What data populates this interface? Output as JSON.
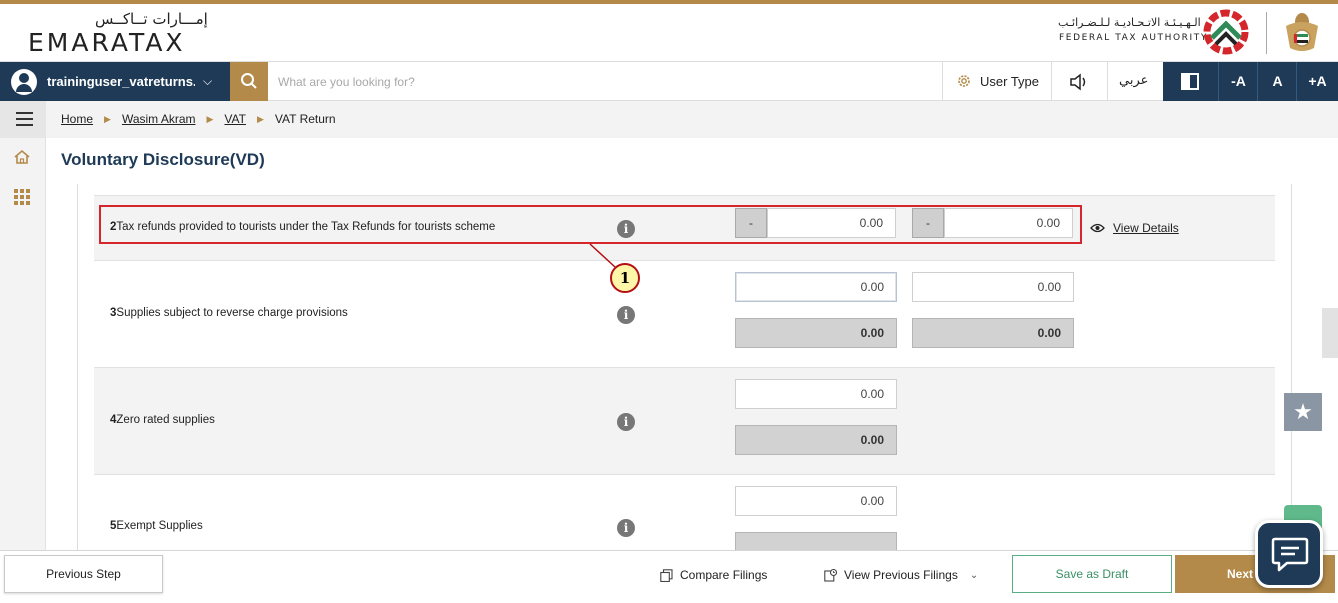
{
  "header": {
    "brand_arabic": "إمـــارات تــاكــس",
    "brand_english": "EMARATAX",
    "authority_arabic": "الـهـيـئـة الاتـحـاديـة لـلـضـرائـب",
    "authority_english": "FEDERAL TAX AUTHORITY"
  },
  "navbar": {
    "username": "traininguser_vatreturns...",
    "search_placeholder": "What are you looking for?",
    "user_type_label": "User Type",
    "language_label": "عربي",
    "font_decrease": "-A",
    "font_normal": "A",
    "font_increase": "+A"
  },
  "breadcrumb": {
    "items": [
      "Home",
      "Wasim Akram",
      "VAT",
      "VAT Return"
    ]
  },
  "page": {
    "title": "Voluntary Disclosure(VD)"
  },
  "rows": [
    {
      "number": "2",
      "label": "Tax refunds provided to tourists under the Tax Refunds for tourists scheme",
      "amount_sign": "-",
      "amount": "0.00",
      "vat_sign": "-",
      "vat": "0.00",
      "link": "View Details"
    },
    {
      "number": "3",
      "label": "Supplies subject to reverse charge provisions",
      "amount": "0.00",
      "vat": "0.00",
      "amount_adjusted": "0.00",
      "vat_adjusted": "0.00"
    },
    {
      "number": "4",
      "label": "Zero rated supplies",
      "amount": "0.00",
      "amount_adjusted": "0.00"
    },
    {
      "number": "5",
      "label": "Exempt Supplies",
      "amount": "0.00"
    }
  ],
  "annotation": {
    "callout_number": "1"
  },
  "footer": {
    "previous_step": "Previous Step",
    "compare_filings": "Compare Filings",
    "view_previous_filings": "View Previous Filings",
    "save_as_draft": "Save as Draft",
    "next": "Next"
  },
  "colors": {
    "navy": "#1e3a57",
    "gold": "#b38a4a",
    "highlight_red": "#d4262b",
    "callout_fill": "#fef6a8",
    "green": "#5aae84"
  }
}
